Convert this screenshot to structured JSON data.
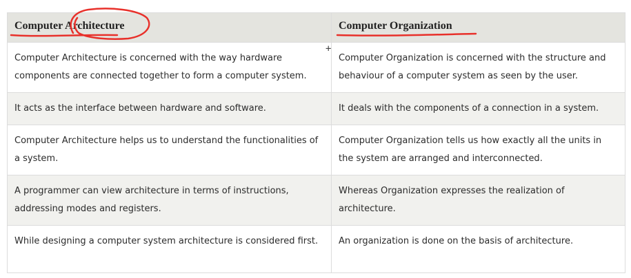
{
  "table": {
    "headers": [
      "Computer Architecture",
      "Computer Organization"
    ],
    "rows": [
      [
        "Computer Architecture is concerned with the way hardware components are connected together to form a computer system.",
        "Computer Organization is concerned with the structure and behaviour of a computer system as seen by the user."
      ],
      [
        "It acts as the interface between hardware and software.",
        "It deals with the components of a connection in a system."
      ],
      [
        "Computer Architecture helps us to understand the functionalities of a system.",
        "Computer Organization tells us how exactly all the units in the system are arranged and interconnected."
      ],
      [
        "A programmer can view architecture in terms of instructions, addressing modes and registers.",
        "Whereas Organization expresses the realization of architecture."
      ],
      [
        "While designing a computer system architecture is considered first.",
        "An organization is done on the basis of architecture."
      ]
    ]
  },
  "annotation": {
    "ink_color": "#e8302a",
    "cursor_glyph": "+"
  }
}
